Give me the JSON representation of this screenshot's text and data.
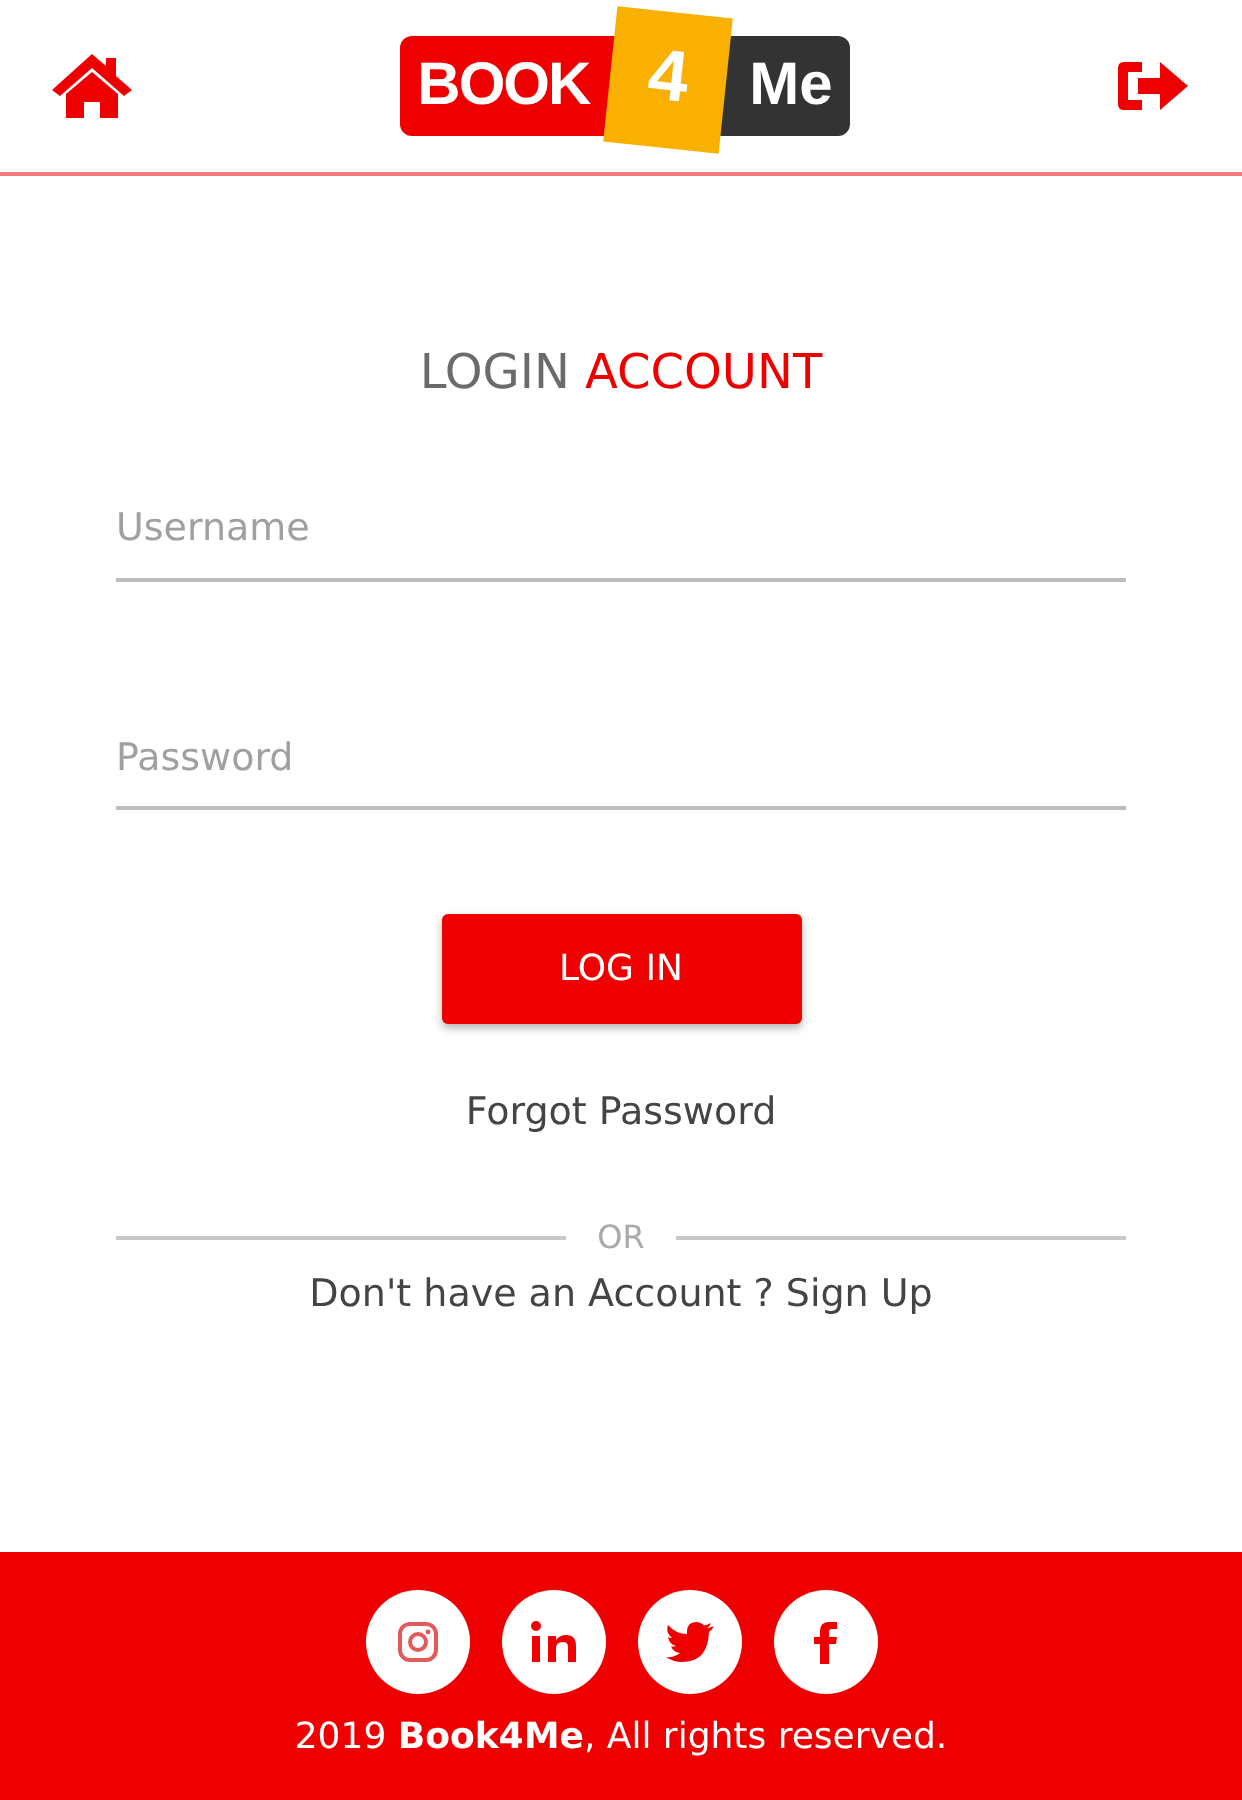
{
  "header": {
    "logo": {
      "part_1": "BOOK",
      "part_2": "4",
      "part_3": "Me"
    }
  },
  "login": {
    "title": "LOGIN **ACCOUNT**",
    "fields": [
      {
        "placeholder": "Username"
      },
      {
        "placeholder": "Password"
      }
    ],
    "submit": "LOG IN",
    "forgot": "Forgot Password",
    "divider": "OR",
    "signup": "Don't have an Account ? Sign Up"
  },
  "footer": {
    "social": [
      {
        "kind": "instagram"
      },
      {
        "kind": "linkedin"
      },
      {
        "kind": "twitter"
      },
      {
        "kind": "facebook"
      }
    ],
    "copyright": "2019 **Book4Me**, All rights reserved."
  }
}
